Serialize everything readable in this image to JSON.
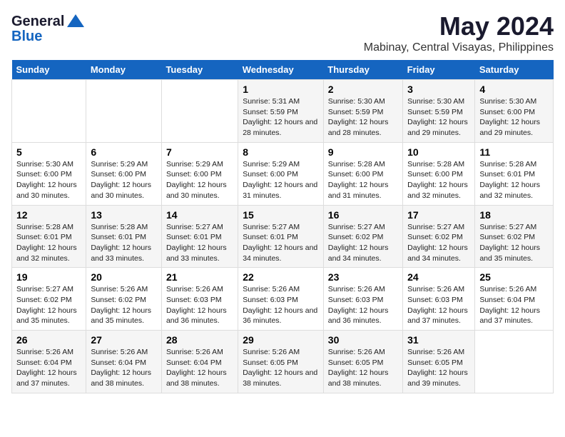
{
  "header": {
    "logo_general": "General",
    "logo_blue": "Blue",
    "title": "May 2024",
    "subtitle": "Mabinay, Central Visayas, Philippines"
  },
  "days_of_week": [
    "Sunday",
    "Monday",
    "Tuesday",
    "Wednesday",
    "Thursday",
    "Friday",
    "Saturday"
  ],
  "weeks": [
    {
      "days": [
        {
          "num": "",
          "content": ""
        },
        {
          "num": "",
          "content": ""
        },
        {
          "num": "",
          "content": ""
        },
        {
          "num": "1",
          "content": "Sunrise: 5:31 AM\nSunset: 5:59 PM\nDaylight: 12 hours and 28 minutes."
        },
        {
          "num": "2",
          "content": "Sunrise: 5:30 AM\nSunset: 5:59 PM\nDaylight: 12 hours and 28 minutes."
        },
        {
          "num": "3",
          "content": "Sunrise: 5:30 AM\nSunset: 5:59 PM\nDaylight: 12 hours and 29 minutes."
        },
        {
          "num": "4",
          "content": "Sunrise: 5:30 AM\nSunset: 6:00 PM\nDaylight: 12 hours and 29 minutes."
        }
      ]
    },
    {
      "days": [
        {
          "num": "5",
          "content": "Sunrise: 5:30 AM\nSunset: 6:00 PM\nDaylight: 12 hours and 30 minutes."
        },
        {
          "num": "6",
          "content": "Sunrise: 5:29 AM\nSunset: 6:00 PM\nDaylight: 12 hours and 30 minutes."
        },
        {
          "num": "7",
          "content": "Sunrise: 5:29 AM\nSunset: 6:00 PM\nDaylight: 12 hours and 30 minutes."
        },
        {
          "num": "8",
          "content": "Sunrise: 5:29 AM\nSunset: 6:00 PM\nDaylight: 12 hours and 31 minutes."
        },
        {
          "num": "9",
          "content": "Sunrise: 5:28 AM\nSunset: 6:00 PM\nDaylight: 12 hours and 31 minutes."
        },
        {
          "num": "10",
          "content": "Sunrise: 5:28 AM\nSunset: 6:00 PM\nDaylight: 12 hours and 32 minutes."
        },
        {
          "num": "11",
          "content": "Sunrise: 5:28 AM\nSunset: 6:01 PM\nDaylight: 12 hours and 32 minutes."
        }
      ]
    },
    {
      "days": [
        {
          "num": "12",
          "content": "Sunrise: 5:28 AM\nSunset: 6:01 PM\nDaylight: 12 hours and 32 minutes."
        },
        {
          "num": "13",
          "content": "Sunrise: 5:28 AM\nSunset: 6:01 PM\nDaylight: 12 hours and 33 minutes."
        },
        {
          "num": "14",
          "content": "Sunrise: 5:27 AM\nSunset: 6:01 PM\nDaylight: 12 hours and 33 minutes."
        },
        {
          "num": "15",
          "content": "Sunrise: 5:27 AM\nSunset: 6:01 PM\nDaylight: 12 hours and 34 minutes."
        },
        {
          "num": "16",
          "content": "Sunrise: 5:27 AM\nSunset: 6:02 PM\nDaylight: 12 hours and 34 minutes."
        },
        {
          "num": "17",
          "content": "Sunrise: 5:27 AM\nSunset: 6:02 PM\nDaylight: 12 hours and 34 minutes."
        },
        {
          "num": "18",
          "content": "Sunrise: 5:27 AM\nSunset: 6:02 PM\nDaylight: 12 hours and 35 minutes."
        }
      ]
    },
    {
      "days": [
        {
          "num": "19",
          "content": "Sunrise: 5:27 AM\nSunset: 6:02 PM\nDaylight: 12 hours and 35 minutes."
        },
        {
          "num": "20",
          "content": "Sunrise: 5:26 AM\nSunset: 6:02 PM\nDaylight: 12 hours and 35 minutes."
        },
        {
          "num": "21",
          "content": "Sunrise: 5:26 AM\nSunset: 6:03 PM\nDaylight: 12 hours and 36 minutes."
        },
        {
          "num": "22",
          "content": "Sunrise: 5:26 AM\nSunset: 6:03 PM\nDaylight: 12 hours and 36 minutes."
        },
        {
          "num": "23",
          "content": "Sunrise: 5:26 AM\nSunset: 6:03 PM\nDaylight: 12 hours and 36 minutes."
        },
        {
          "num": "24",
          "content": "Sunrise: 5:26 AM\nSunset: 6:03 PM\nDaylight: 12 hours and 37 minutes."
        },
        {
          "num": "25",
          "content": "Sunrise: 5:26 AM\nSunset: 6:04 PM\nDaylight: 12 hours and 37 minutes."
        }
      ]
    },
    {
      "days": [
        {
          "num": "26",
          "content": "Sunrise: 5:26 AM\nSunset: 6:04 PM\nDaylight: 12 hours and 37 minutes."
        },
        {
          "num": "27",
          "content": "Sunrise: 5:26 AM\nSunset: 6:04 PM\nDaylight: 12 hours and 38 minutes."
        },
        {
          "num": "28",
          "content": "Sunrise: 5:26 AM\nSunset: 6:04 PM\nDaylight: 12 hours and 38 minutes."
        },
        {
          "num": "29",
          "content": "Sunrise: 5:26 AM\nSunset: 6:05 PM\nDaylight: 12 hours and 38 minutes."
        },
        {
          "num": "30",
          "content": "Sunrise: 5:26 AM\nSunset: 6:05 PM\nDaylight: 12 hours and 38 minutes."
        },
        {
          "num": "31",
          "content": "Sunrise: 5:26 AM\nSunset: 6:05 PM\nDaylight: 12 hours and 39 minutes."
        },
        {
          "num": "",
          "content": ""
        }
      ]
    }
  ]
}
